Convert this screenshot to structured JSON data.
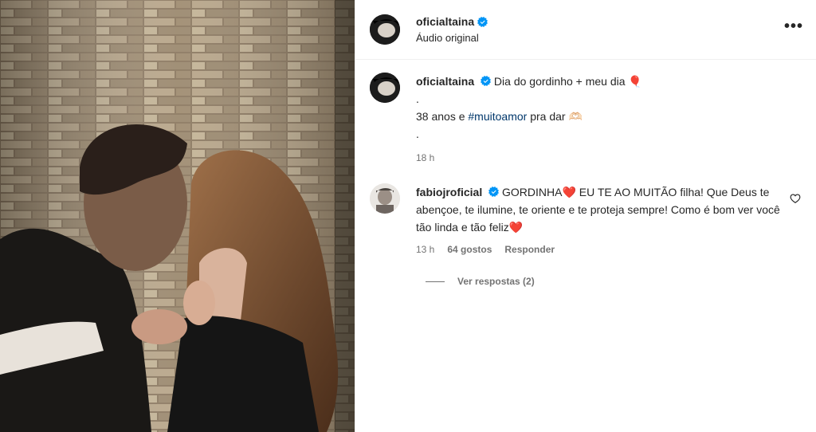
{
  "header": {
    "username": "oficialtaina",
    "subtitle": "Áudio original",
    "more_icon": "more-horizontal-icon"
  },
  "post": {
    "username": "oficialtaina",
    "line1": "Dia do gordinho + meu dia 🎈",
    "dot1": ".",
    "line3_before": "38 anos e ",
    "hashtag": "#muitoamor",
    "line3_after": " pra dar 🫶🏻",
    "dot2": ".",
    "time": "18 h"
  },
  "comment": {
    "username": "fabiojroficial",
    "text_part1": "GORDINHA",
    "text_part2": "  EU TE AO MUITÃO filha! Que Deus te abençoe, te ilumine, te oriente e te proteja sempre! Como é bom ver você tão linda e tão feliz",
    "heart": "❤️",
    "time": "13 h",
    "likes": "64 gostos",
    "reply": "Responder",
    "view_replies": "Ver respostas (2)",
    "like_icon": "heart-outline-icon"
  },
  "colors": {
    "verified": "#0095f6",
    "hashtag": "#00376b",
    "muted": "#737373",
    "text": "#262626"
  }
}
